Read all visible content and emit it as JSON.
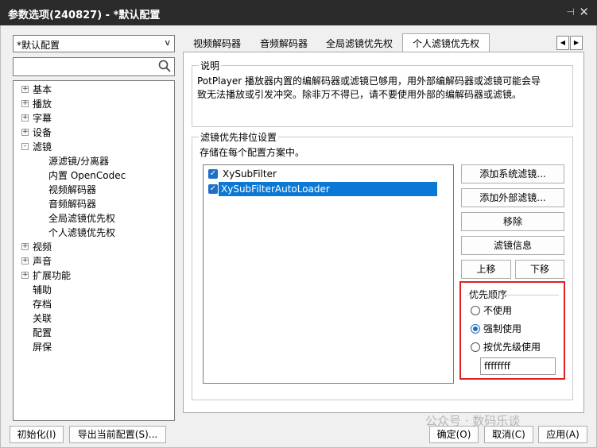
{
  "window": {
    "title": "参数选项(240827) - *默认配置",
    "pin": "⊣",
    "close": "✕"
  },
  "profile": {
    "selected": "*默认配置",
    "arrow": "v"
  },
  "search": {
    "value": ""
  },
  "tree": {
    "expand_symbol": "+",
    "collapse_symbol": "-",
    "items": [
      {
        "label": "基本",
        "exp": "+"
      },
      {
        "label": "播放",
        "exp": "+"
      },
      {
        "label": "字幕",
        "exp": "+"
      },
      {
        "label": "设备",
        "exp": "+"
      },
      {
        "label": "滤镜",
        "exp": "-"
      },
      {
        "label": "源滤镜/分离器"
      },
      {
        "label": "内置 OpenCodec"
      },
      {
        "label": "视频解码器"
      },
      {
        "label": "音频解码器"
      },
      {
        "label": "全局滤镜优先权"
      },
      {
        "label": "个人滤镜优先权"
      },
      {
        "label": "视频",
        "exp": "+"
      },
      {
        "label": "声音",
        "exp": "+"
      },
      {
        "label": "扩展功能",
        "exp": "+"
      },
      {
        "label": "辅助"
      },
      {
        "label": "存档"
      },
      {
        "label": "关联"
      },
      {
        "label": "配置"
      },
      {
        "label": "屏保"
      }
    ]
  },
  "tabs": [
    "视频解码器",
    "音频解码器",
    "全局滤镜优先权",
    "个人滤镜优先权"
  ],
  "tab_nav": {
    "prev": "◀",
    "next": "▶"
  },
  "description": {
    "title": "说明",
    "line1": "PotPlayer 播放器内置的编解码器或滤镜已够用，用外部编解码器或滤镜可能会导",
    "line2": "致无法播放或引发冲突。除非万不得已，请不要使用外部的编解码器或滤镜。"
  },
  "filter_priority": {
    "title": "滤镜优先排位设置",
    "subtitle": "存储在每个配置方案中。",
    "check": "✓",
    "filters": [
      "XySubFilter",
      "XySubFilterAutoLoader"
    ],
    "buttons": {
      "add_system": "添加系统滤镜...",
      "add_external": "添加外部滤镜...",
      "remove": "移除",
      "info": "滤镜信息",
      "up": "上移",
      "down": "下移"
    }
  },
  "priority_order": {
    "title": "优先顺序",
    "options": [
      "不使用",
      "强制使用",
      "按优先级使用"
    ],
    "selected_index": 1,
    "value": "ffffffff"
  },
  "footer": {
    "init": "初始化(I)",
    "export": "导出当前配置(S)...",
    "ok": "确定(O)",
    "cancel": "取消(C)",
    "apply": "应用(A)"
  },
  "watermark": "公众号 · 数码乐谈"
}
